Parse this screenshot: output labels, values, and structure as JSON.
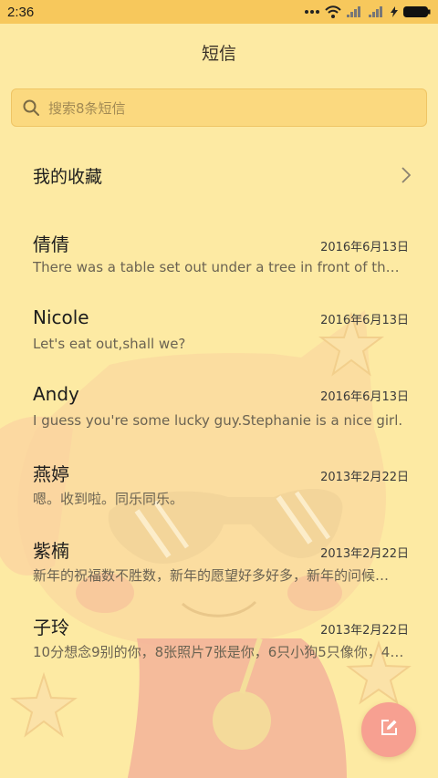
{
  "status_bar": {
    "time": "2:36",
    "icons": [
      "more-dots-icon",
      "wifi-icon",
      "signal-icon",
      "signal-icon",
      "charging-icon",
      "battery-icon"
    ]
  },
  "header": {
    "title": "短信"
  },
  "search": {
    "placeholder": "搜索8条短信",
    "icon": "search-icon"
  },
  "favorites": {
    "label": "我的收藏",
    "icon": "chevron-right-icon"
  },
  "conversations": [
    {
      "name": "倩倩",
      "date": "2016年6月13日",
      "preview": "There was a table set out under a tree in front of the h…"
    },
    {
      "name": "Nicole",
      "date": "2016年6月13日",
      "preview": "Let's eat out,shall we?"
    },
    {
      "name": "Andy",
      "date": "2016年6月13日",
      "preview": "I guess you're some lucky guy.Stephanie is a nice girl."
    },
    {
      "name": "燕婷",
      "date": "2013年2月22日",
      "preview": "嗯。收到啦。同乐同乐。"
    },
    {
      "name": "紫楠",
      "date": "2013年2月22日",
      "preview": "新年的祝福数不胜数，新年的愿望好多好多，新年的问候…"
    },
    {
      "name": "子玲",
      "date": "2013年2月22日",
      "preview": "10分想念9别的你，8张照片7张是你，6只小狗5只像你，4…"
    }
  ],
  "compose": {
    "icon": "compose-icon"
  },
  "colors": {
    "status_bar": "#f7c85c",
    "background": "#fdeaa3",
    "search_bg": "#fbd97f",
    "fab": "#f7a091"
  }
}
